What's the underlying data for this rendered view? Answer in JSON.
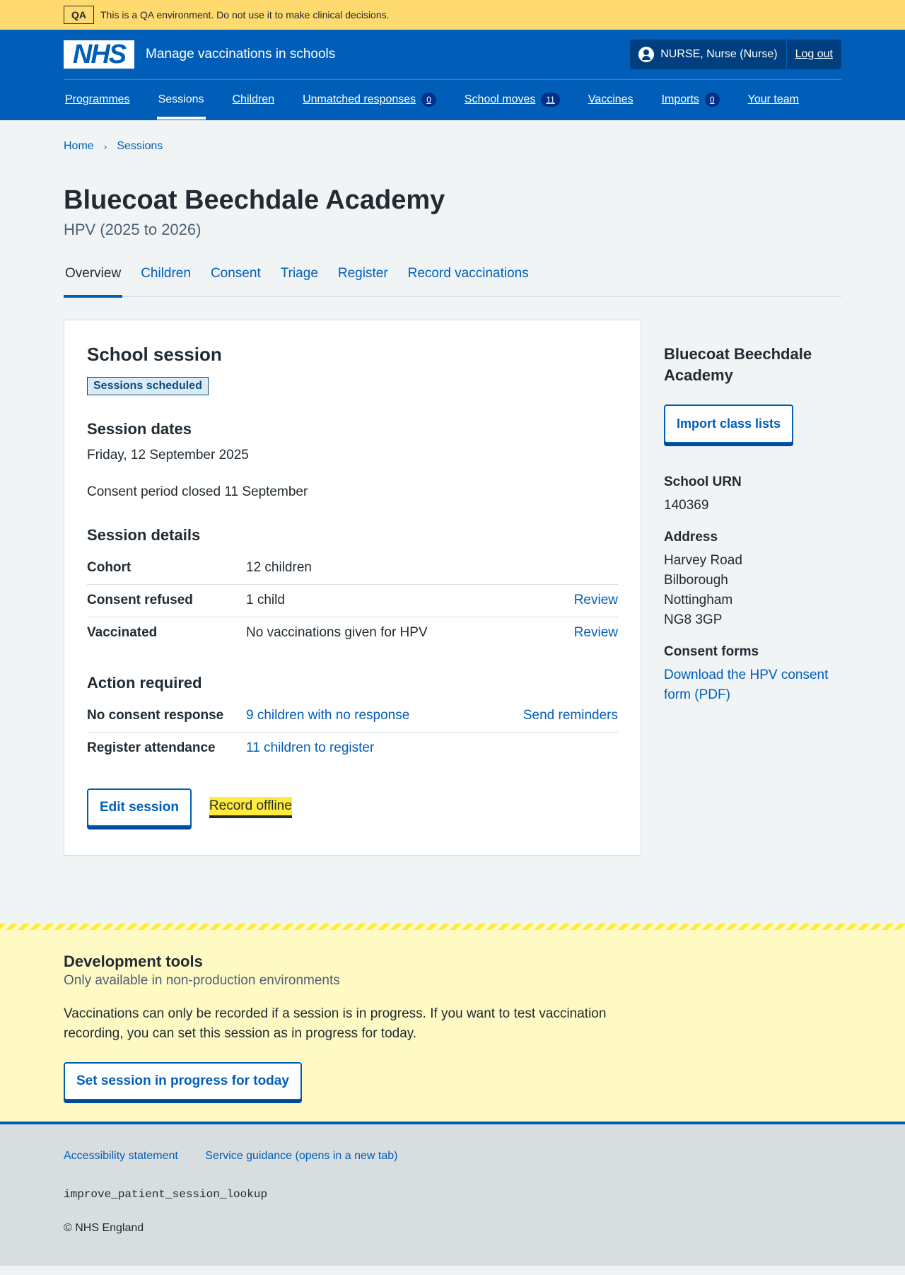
{
  "qa_banner": {
    "tag": "QA",
    "text": "This is a QA environment. Do not use it to make clinical decisions."
  },
  "header": {
    "logo": "NHS",
    "service_name": "Manage vaccinations in schools",
    "user": "NURSE, Nurse (Nurse)",
    "logout": "Log out",
    "nav": [
      {
        "label": "Programmes"
      },
      {
        "label": "Sessions"
      },
      {
        "label": "Children"
      },
      {
        "label": "Unmatched responses",
        "count": "0"
      },
      {
        "label": "School moves",
        "count": "11"
      },
      {
        "label": "Vaccines"
      },
      {
        "label": "Imports",
        "count": "0"
      },
      {
        "label": "Your team"
      }
    ]
  },
  "breadcrumb": [
    "Home",
    "Sessions"
  ],
  "page": {
    "title": "Bluecoat Beechdale Academy",
    "caption": "HPV (2025 to 2026)"
  },
  "tabs": [
    "Overview",
    "Children",
    "Consent",
    "Triage",
    "Register",
    "Record vaccinations"
  ],
  "session": {
    "heading": "School session",
    "status": "Sessions scheduled",
    "dates_heading": "Session dates",
    "date": "Friday, 12 September 2025",
    "consent_period": "Consent period closed 11 September",
    "details_heading": "Session details",
    "details": [
      {
        "key": "Cohort",
        "value": "12 children",
        "action": ""
      },
      {
        "key": "Consent refused",
        "value": "1 child",
        "action": "Review"
      },
      {
        "key": "Vaccinated",
        "value": "No vaccinations given for HPV",
        "action": "Review"
      }
    ],
    "action_heading": "Action required",
    "actions": [
      {
        "key": "No consent response",
        "value": "9 children with no response",
        "action": "Send reminders"
      },
      {
        "key": "Register attendance",
        "value": "11 children to register",
        "action": ""
      }
    ],
    "edit_button": "Edit session",
    "record_offline": "Record offline"
  },
  "sidebar": {
    "school": "Bluecoat Beechdale Academy",
    "import_button": "Import class lists",
    "urn_label": "School URN",
    "urn": "140369",
    "address_label": "Address",
    "address": [
      "Harvey Road",
      "Bilborough",
      "Nottingham",
      "NG8 3GP"
    ],
    "consent_label": "Consent forms",
    "consent_link": "Download the HPV consent form (PDF)"
  },
  "dev_tools": {
    "heading": "Development tools",
    "caption": "Only available in non-production environments",
    "text": "Vaccinations can only be recorded if a session is in progress. If you want to test vaccination recording, you can set this session as in progress for today.",
    "button": "Set session in progress for today"
  },
  "footer": {
    "links": [
      "Accessibility statement",
      "Service guidance (opens in a new tab)"
    ],
    "code": "improve_patient_session_lookup",
    "copyright": "© NHS England"
  },
  "colors": {
    "brand": "#005eb8",
    "qa": "#ffda6e",
    "dev": "#fff9c4",
    "focus": "#ffeb3b"
  }
}
